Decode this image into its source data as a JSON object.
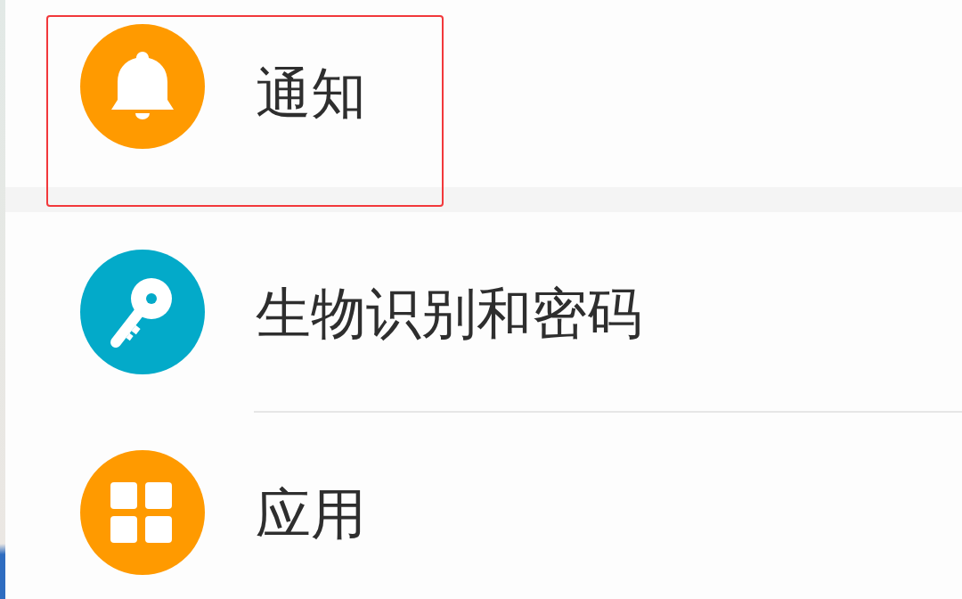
{
  "groups": [
    {
      "items": [
        {
          "label": "通知",
          "kind": "bell",
          "color": "#ff9a00",
          "highlighted": true
        }
      ]
    },
    {
      "items": [
        {
          "label": "生物识别和密码",
          "kind": "key",
          "color": "#03aac9",
          "highlighted": false
        },
        {
          "label": "应用",
          "kind": "grid",
          "color": "#ff9a00",
          "highlighted": false
        }
      ]
    }
  ]
}
